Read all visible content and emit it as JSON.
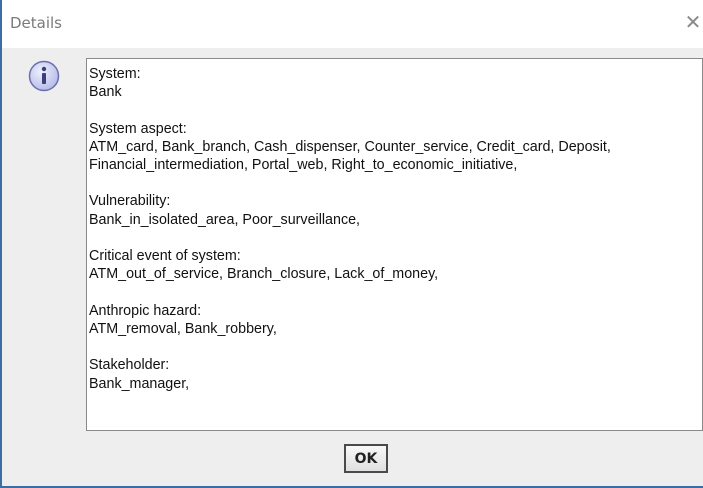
{
  "dialog": {
    "title": "Details",
    "close_glyph": "✕",
    "icon": "info-icon",
    "ok_label": "OK"
  },
  "details": {
    "system_label": "System:",
    "system_value": "Bank",
    "aspect_label": "System aspect:",
    "aspect_value_line1": "ATM_card, Bank_branch, Cash_dispenser, Counter_service, Credit_card, Deposit,",
    "aspect_value_line2": "Financial_intermediation, Portal_web, Right_to_economic_initiative,",
    "vulnerability_label": "Vulnerability:",
    "vulnerability_value": "Bank_in_isolated_area, Poor_surveillance,",
    "critical_label": "Critical event of system:",
    "critical_value": "ATM_out_of_service, Branch_closure, Lack_of_money,",
    "hazard_label": "Anthropic hazard:",
    "hazard_value": "ATM_removal, Bank_robbery,",
    "stakeholder_label": "Stakeholder:",
    "stakeholder_value": "Bank_manager,"
  },
  "colors": {
    "window_bg": "#eeeeee",
    "title_bg": "#ffffff",
    "border_accent": "#3a6ea5",
    "icon_fill": "#c9cdf0"
  }
}
